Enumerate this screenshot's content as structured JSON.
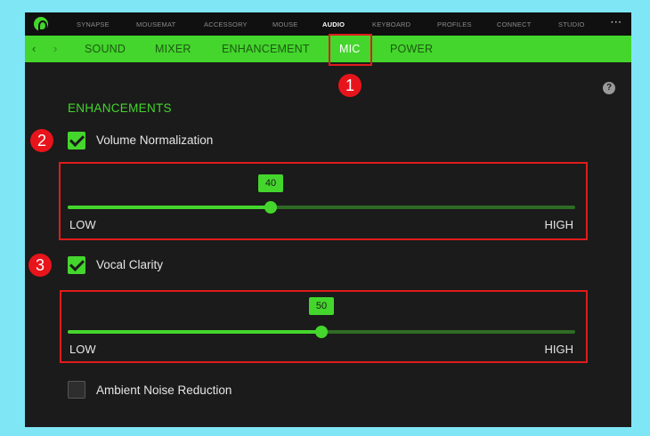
{
  "topnav": {
    "items": [
      "SYNAPSE",
      "MOUSEMAT",
      "ACCESSORY",
      "MOUSE",
      "AUDIO",
      "KEYBOARD",
      "PROFILES",
      "CONNECT",
      "STUDIO"
    ],
    "active": "AUDIO",
    "more": "···"
  },
  "subnav": {
    "back": "‹",
    "forward": "›",
    "tabs": [
      "SOUND",
      "MIXER",
      "ENHANCEMENT",
      "MIC",
      "POWER"
    ],
    "active": "MIC"
  },
  "help": "?",
  "section": {
    "title": "ENHANCEMENTS"
  },
  "options": [
    {
      "label": "Volume Normalization",
      "checked": true,
      "slider": {
        "value": 40,
        "value_text": "40",
        "min": 0,
        "max": 100,
        "low_label": "LOW",
        "high_label": "HIGH"
      }
    },
    {
      "label": "Vocal Clarity",
      "checked": true,
      "slider": {
        "value": 50,
        "value_text": "50",
        "min": 0,
        "max": 100,
        "low_label": "LOW",
        "high_label": "HIGH"
      }
    },
    {
      "label": "Ambient Noise Reduction",
      "checked": false
    }
  ],
  "markers": [
    "1",
    "2",
    "3"
  ],
  "colors": {
    "accent": "#44d62c",
    "background": "#1b1b1b",
    "highlight": "#e11b1b",
    "marker": "#e8141b",
    "outer": "#7fe6f5"
  }
}
